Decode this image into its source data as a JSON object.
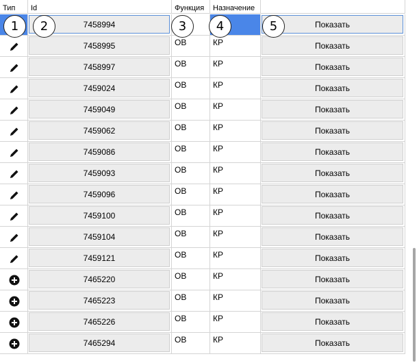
{
  "columns": {
    "type": "Тип",
    "id": "Id",
    "function": "Функция",
    "destination": "Назначение"
  },
  "rows": [
    {
      "type": "pencil-icon",
      "id": "7458994",
      "function": "",
      "destination": "",
      "action": "Показать"
    },
    {
      "type": "pencil-icon",
      "id": "7458995",
      "function": "ОВ",
      "destination": "КР",
      "action": "Показать"
    },
    {
      "type": "pencil-icon",
      "id": "7458997",
      "function": "ОВ",
      "destination": "КР",
      "action": "Показать"
    },
    {
      "type": "pencil-icon",
      "id": "7459024",
      "function": "ОВ",
      "destination": "КР",
      "action": "Показать"
    },
    {
      "type": "pencil-icon",
      "id": "7459049",
      "function": "ОВ",
      "destination": "КР",
      "action": "Показать"
    },
    {
      "type": "pencil-icon",
      "id": "7459062",
      "function": "ОВ",
      "destination": "КР",
      "action": "Показать"
    },
    {
      "type": "pencil-icon",
      "id": "7459086",
      "function": "ОВ",
      "destination": "КР",
      "action": "Показать"
    },
    {
      "type": "pencil-icon",
      "id": "7459093",
      "function": "ОВ",
      "destination": "КР",
      "action": "Показать"
    },
    {
      "type": "pencil-icon",
      "id": "7459096",
      "function": "ОВ",
      "destination": "КР",
      "action": "Показать"
    },
    {
      "type": "pencil-icon",
      "id": "7459100",
      "function": "ОВ",
      "destination": "КР",
      "action": "Показать"
    },
    {
      "type": "pencil-icon",
      "id": "7459104",
      "function": "ОВ",
      "destination": "КР",
      "action": "Показать"
    },
    {
      "type": "pencil-icon",
      "id": "7459121",
      "function": "ОВ",
      "destination": "КР",
      "action": "Показать"
    },
    {
      "type": "plus-circle-icon",
      "id": "7465220",
      "function": "ОВ",
      "destination": "КР",
      "action": "Показать"
    },
    {
      "type": "plus-circle-icon",
      "id": "7465223",
      "function": "ОВ",
      "destination": "КР",
      "action": "Показать"
    },
    {
      "type": "plus-circle-icon",
      "id": "7465226",
      "function": "ОВ",
      "destination": "КР",
      "action": "Показать"
    },
    {
      "type": "plus-circle-icon",
      "id": "7465294",
      "function": "ОВ",
      "destination": "КР",
      "action": "Показать"
    }
  ],
  "selected_row": 0,
  "annotations": [
    "1",
    "2",
    "3",
    "4",
    "5"
  ],
  "colors": {
    "selection": "#4a86e8",
    "button": "#ececec",
    "grid_line": "#d4d4d4"
  }
}
